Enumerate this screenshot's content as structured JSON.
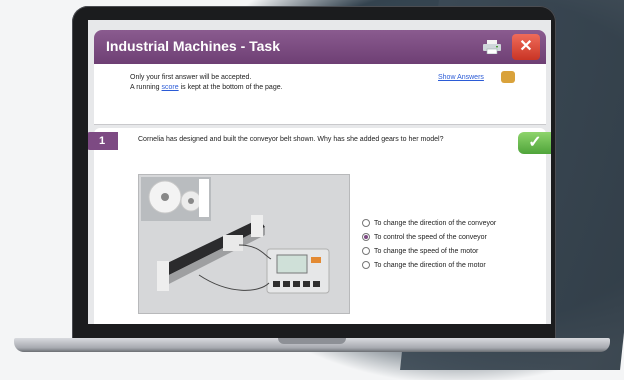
{
  "window": {
    "title": "Industrial Machines - Task",
    "close_label": "✕"
  },
  "info": {
    "line1": "Only your first answer will be accepted.",
    "line2_prefix": "A running ",
    "line2_link": "score",
    "line2_suffix": " is kept at the bottom of the page.",
    "show_answers": "Show Answers"
  },
  "question": {
    "number": "1",
    "text": "Cornelia has designed and built the conveyor belt shown. Why has she added gears to her model?",
    "check_label": "✓",
    "options": [
      {
        "label": "To change the direction of the conveyor",
        "selected": false
      },
      {
        "label": "To control the speed of the conveyor",
        "selected": true
      },
      {
        "label": "To change the speed of the motor",
        "selected": false
      },
      {
        "label": "To change the direction of the motor",
        "selected": false
      }
    ]
  },
  "colors": {
    "title_bar": "#7d4a83",
    "close": "#d9432f",
    "check": "#5fb446"
  }
}
